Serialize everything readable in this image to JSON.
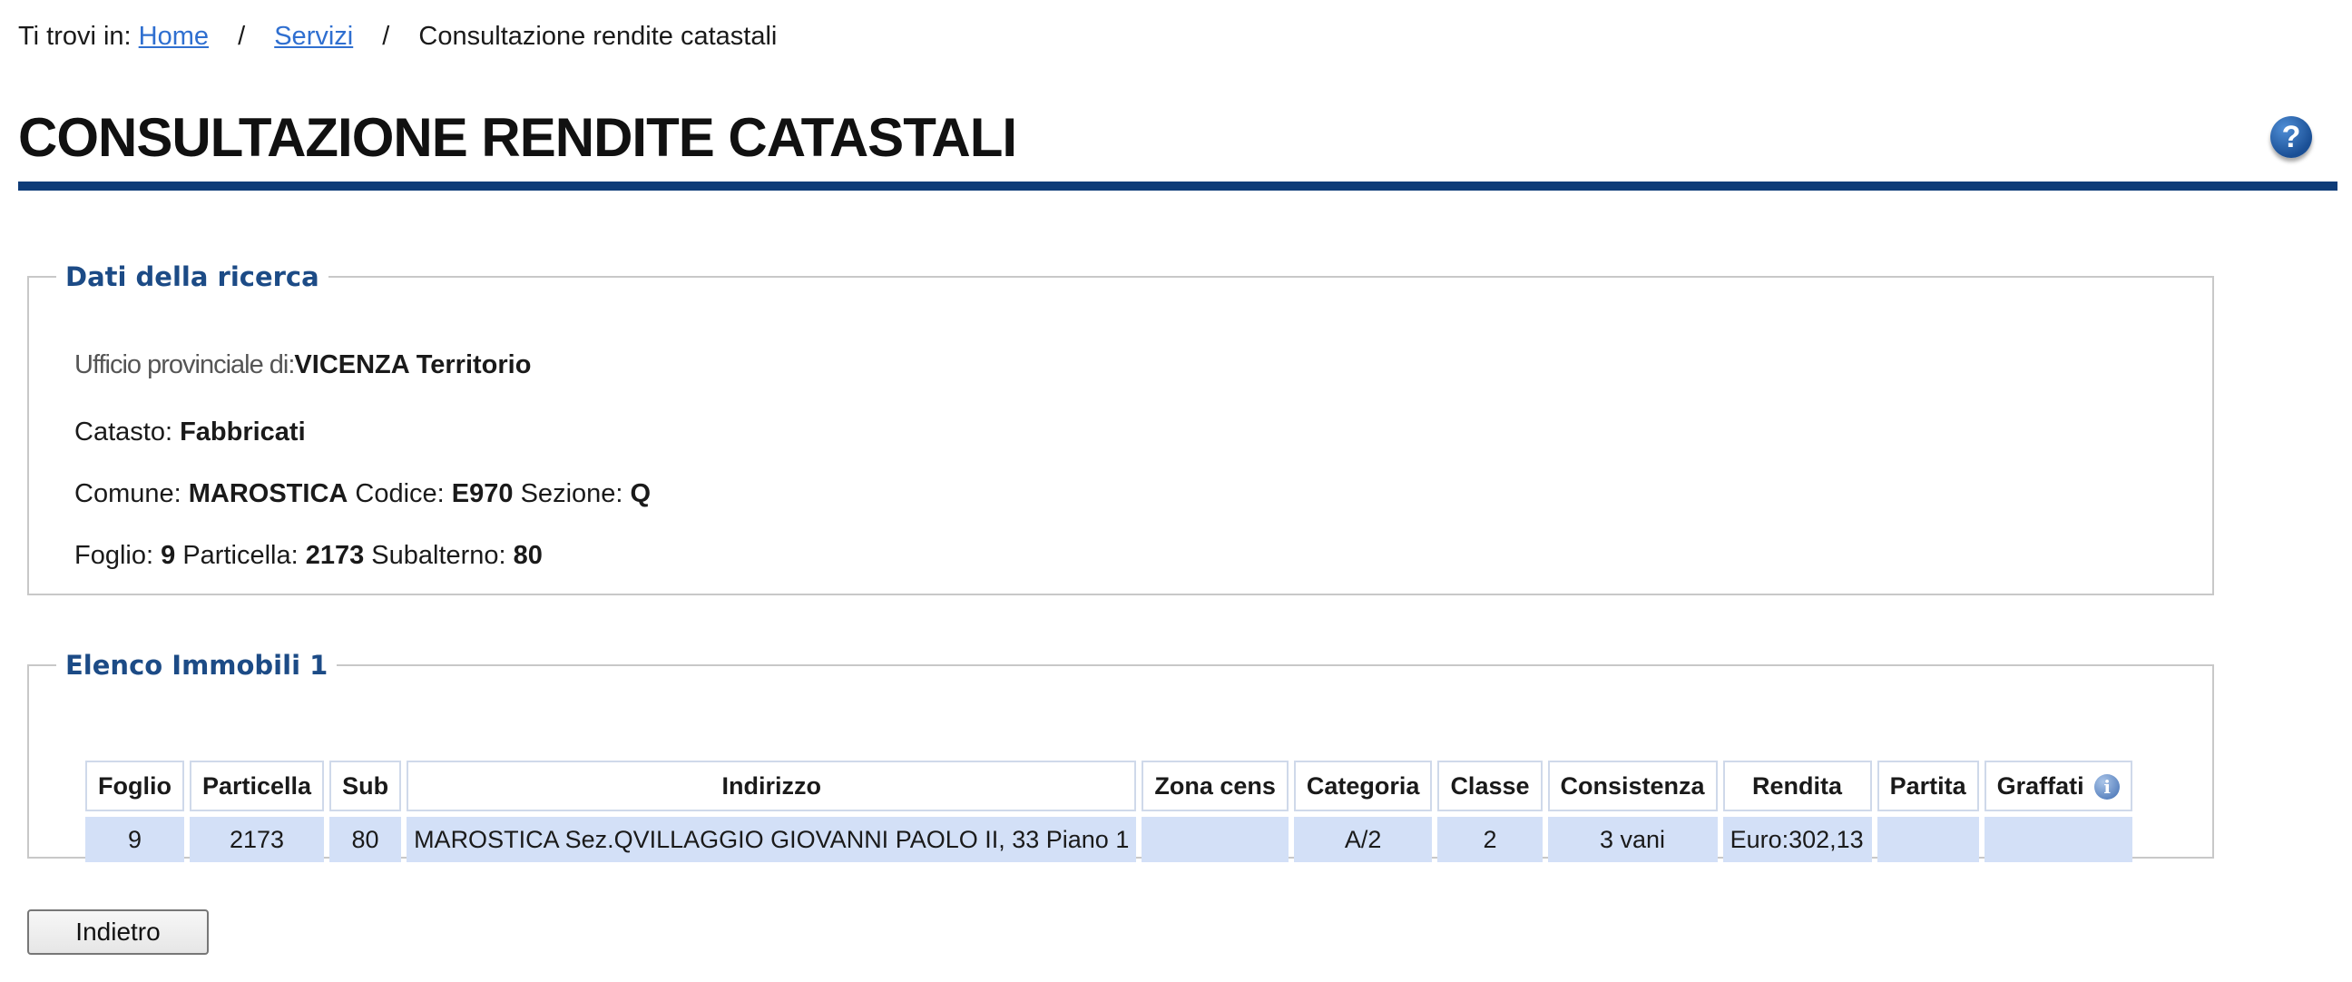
{
  "breadcrumb": {
    "prefix": "Ti trovi in:",
    "home": "Home",
    "separator": "/",
    "servizi": "Servizi",
    "current": "Consultazione rendite catastali"
  },
  "page": {
    "title": "CONSULTAZIONE RENDITE CATASTALI",
    "help_icon": "question-icon",
    "help_glyph": "?"
  },
  "search": {
    "legend": "Dati della ricerca",
    "ufficio_label": "Ufficio provinciale di:",
    "ufficio_value": "VICENZA Territorio",
    "catasto_label": "Catasto:",
    "catasto_value": "Fabbricati",
    "comune_label": "Comune:",
    "comune_value": "MAROSTICA",
    "codice_label": "Codice:",
    "codice_value": "E970",
    "sezione_label": "Sezione:",
    "sezione_value": "Q",
    "foglio_label": "Foglio:",
    "foglio_value": "9",
    "particella_label": "Particella:",
    "particella_value": "2173",
    "subalterno_label": "Subalterno:",
    "subalterno_value": "80"
  },
  "results": {
    "legend": "Elenco Immobili 1",
    "columns": [
      "Foglio",
      "Particella",
      "Sub",
      "Indirizzo",
      "Zona cens",
      "Categoria",
      "Classe",
      "Consistenza",
      "Rendita",
      "Partita",
      "Graffati"
    ],
    "info_icon": "info-icon",
    "info_glyph": "i",
    "rows": [
      [
        "9",
        "2173",
        "80",
        "MAROSTICA Sez.QVILLAGGIO GIOVANNI PAOLO II, 33 Piano 1",
        "",
        "A/2",
        "2",
        "3 vani",
        "Euro:302,13",
        "",
        ""
      ]
    ]
  },
  "actions": {
    "back_label": "Indietro"
  },
  "colors": {
    "accent": "#0e3c78",
    "legend": "#1c4b86",
    "link": "#2f6fd0",
    "cell_bg": "#d3e0f7"
  }
}
